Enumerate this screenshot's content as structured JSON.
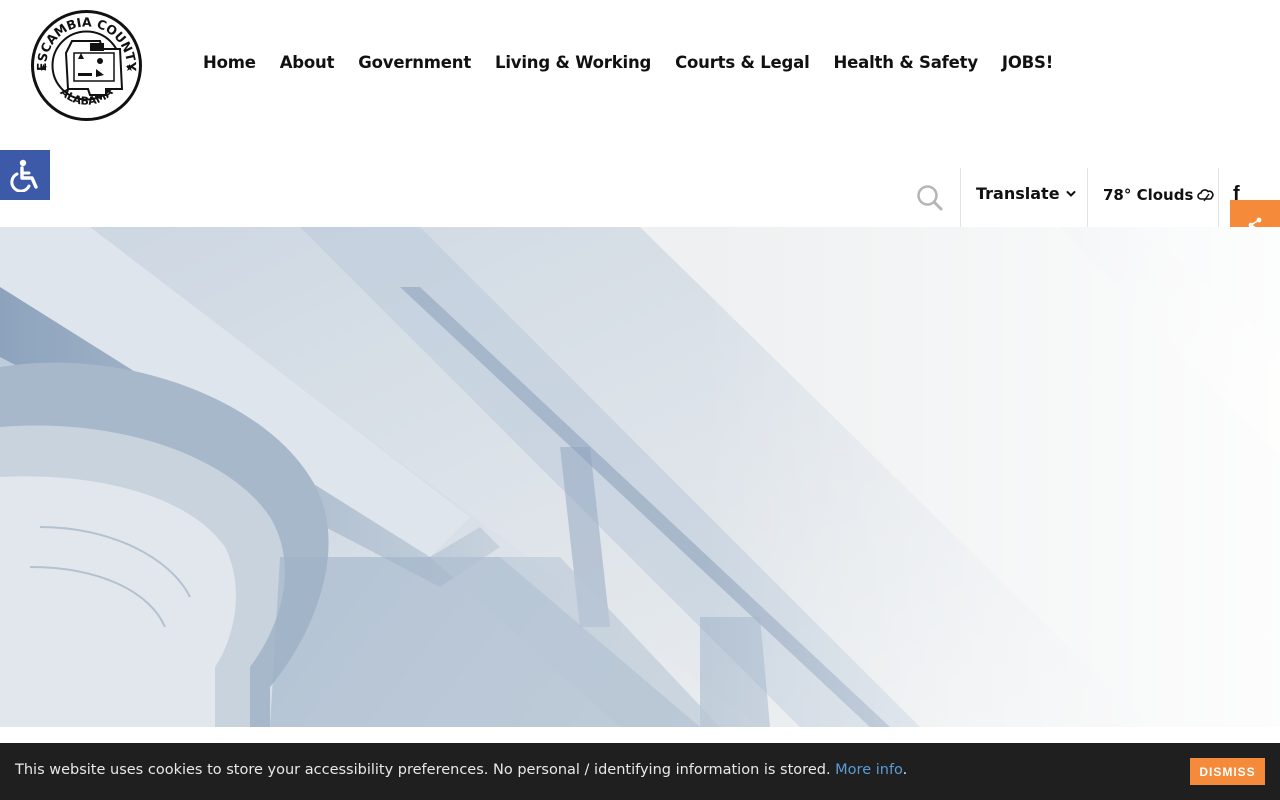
{
  "logo": {
    "text_top": "ESCAMBIA COUNTY",
    "text_bottom": "ALABAMA",
    "icon": "county-seal-icon"
  },
  "nav": {
    "items": [
      {
        "label": "Home"
      },
      {
        "label": "About"
      },
      {
        "label": "Government"
      },
      {
        "label": "Living & Working"
      },
      {
        "label": "Courts & Legal"
      },
      {
        "label": "Health & Safety"
      },
      {
        "label": "JOBS!"
      }
    ]
  },
  "utility": {
    "search_icon": "search-icon",
    "translate_label": "Translate",
    "weather_label": "78° Clouds",
    "facebook_label": "f"
  },
  "accessibility": {
    "icon": "wheelchair-icon",
    "color": "#3d5aa8"
  },
  "share": {
    "icon": "share-icon",
    "color": "#f58a3b"
  },
  "cookie": {
    "message": "This website uses cookies to store your accessibility preferences. No personal / identifying information is stored.",
    "link_label": "More info",
    "period": ".",
    "dismiss_label": "DISMISS",
    "accent": "#f58a3b",
    "background": "#1f1f1f"
  }
}
